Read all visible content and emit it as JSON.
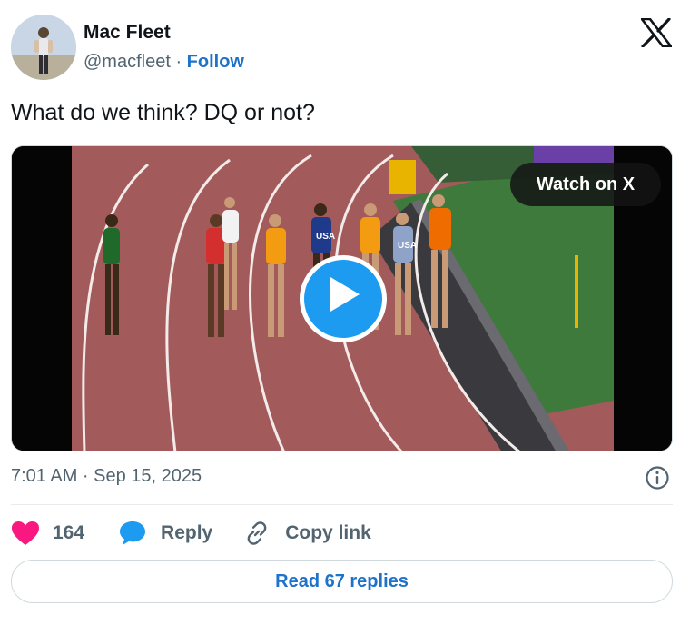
{
  "author": {
    "name": "Mac Fleet",
    "handle": "@macfleet",
    "separator": " · ",
    "follow_label": "Follow"
  },
  "tweet": {
    "text": "What do we think? DQ or not?"
  },
  "media": {
    "watch_label": "Watch on X",
    "bib_labels": [
      "USA",
      "USA"
    ]
  },
  "meta": {
    "timestamp": "7:01 AM · Sep 15, 2025"
  },
  "actions": {
    "like_count": "164",
    "reply_label": "Reply",
    "copy_label": "Copy link"
  },
  "footer": {
    "read_replies_label": "Read 67 replies"
  },
  "colors": {
    "like": "#f91880",
    "reply": "#1d9bf0",
    "link": "#1d72c9",
    "track": "#a25a5a",
    "infield": "#3e7a3c"
  }
}
